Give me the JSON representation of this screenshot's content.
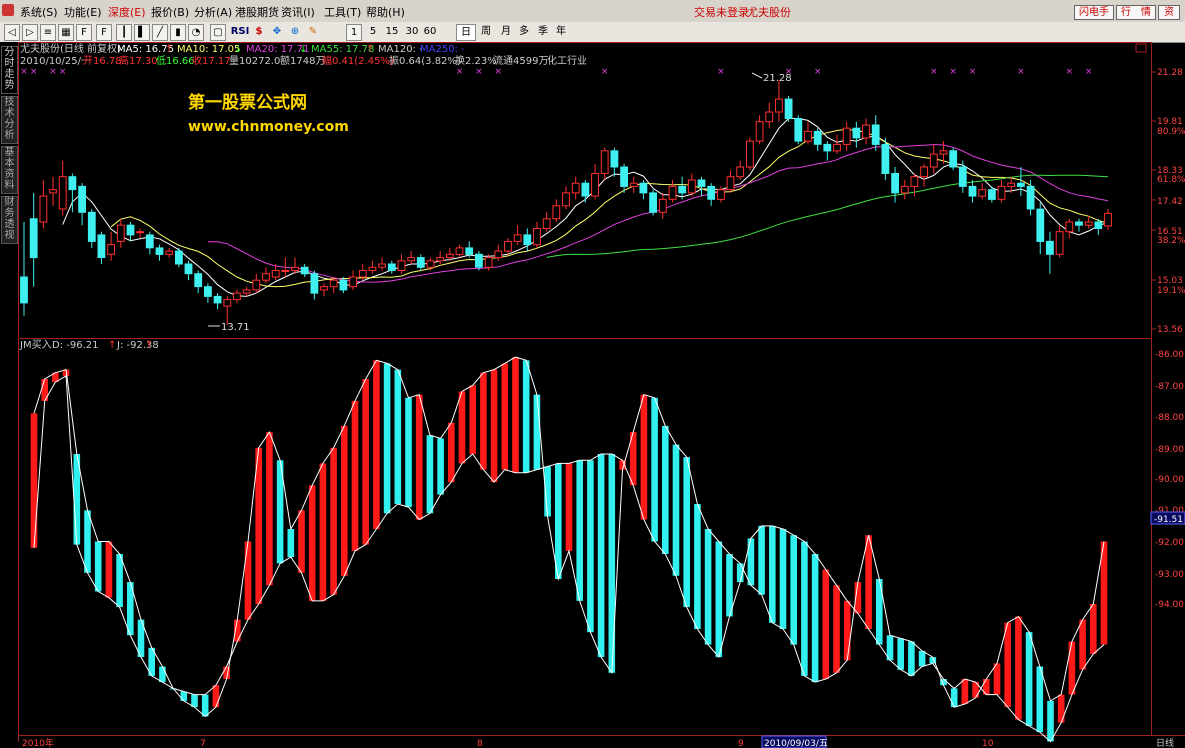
{
  "menubar": {
    "items": [
      "系统(S)",
      "功能(E)",
      "深度(E)",
      "报价(B)",
      "分析(A)",
      "港股期货",
      "资讯(I)",
      "工具(T)",
      "帮助(H)"
    ],
    "status_left": "交易未登录",
    "status_stock": "尤夫股份",
    "btn_flash": "闪电手",
    "btn_quote": "行　情",
    "btn_more": "资"
  },
  "toolbar": {
    "periods": [
      "1",
      "5",
      "15",
      "30",
      "60"
    ],
    "period_tabs": [
      "日",
      "周",
      "月",
      "多",
      "季",
      "年"
    ],
    "rsi_label": "RSI"
  },
  "sidetabs": [
    "分时走势",
    "技术分析",
    "基本资料",
    "财务透视"
  ],
  "watermark": {
    "line1": "第一股票公式网",
    "line2": "www.chnmoney.com"
  },
  "info": {
    "line1": {
      "name": "尤夫股份(日线 前复权)",
      "ma5": "MA5: 16.75",
      "ma10": "MA10: 17.05",
      "ma20": "MA20: 17.71",
      "ma55": "MA55: 17.78",
      "ma120": "MA120: -",
      "ma250": "MA250: -"
    },
    "line2": {
      "date": "2010/10/25/一",
      "open": "开16.78",
      "high": "高17.30",
      "low": "低16.66",
      "close": "收17.17",
      "volume": "量10272.0",
      "amount": "额1748万",
      "change": "幅0.41(2.45%)",
      "amplitude": "振0.64(3.82%)",
      "turnover": "换2.23%",
      "float": "流通4599万",
      "industry": "化工行业"
    },
    "ind_label": "JM买入",
    "ind_d": "D: -96.21",
    "ind_j": "J: -92.38"
  },
  "axis": {
    "price_ticks": [
      "21.28",
      "19.81",
      "18.33",
      "17.42",
      "16.51",
      "15.03",
      "13.56"
    ],
    "fib_ticks": [
      "80.9%",
      "61.8%",
      "38.2%",
      "19.1%"
    ],
    "ind_ticks": [
      "-86.00",
      "-87.00",
      "-88.00",
      "-89.00",
      "-90.00",
      "-91.00",
      "-92.00",
      "-93.00",
      "-94.00"
    ],
    "ind_current": "-91.51",
    "x_ticks": [
      "2010年",
      "7",
      "8",
      "9",
      "10"
    ],
    "cursor_date": "2010/09/03/五",
    "bottom_right": "日线",
    "high_label": "21.28",
    "low_label": "13.71"
  },
  "chart_data": [
    {
      "type": "candlestick",
      "title": "尤夫股份(日线 前复权)",
      "ylim": [
        13.56,
        21.6
      ],
      "ohlc": [
        [
          15.2,
          14.4,
          16.9,
          14.0
        ],
        [
          17.0,
          15.8,
          17.8,
          14.9
        ],
        [
          16.9,
          17.7,
          18.2,
          16.7
        ],
        [
          17.8,
          17.9,
          18.3,
          17.4
        ],
        [
          17.3,
          18.3,
          18.8,
          17.1
        ],
        [
          18.3,
          17.9,
          18.4,
          17.2
        ],
        [
          18.0,
          17.2,
          18.1,
          16.8
        ],
        [
          17.2,
          16.3,
          17.3,
          16.1
        ],
        [
          16.5,
          15.8,
          16.6,
          15.6
        ],
        [
          15.9,
          16.2,
          16.6,
          15.7
        ],
        [
          16.3,
          16.8,
          17.0,
          16.1
        ],
        [
          16.8,
          16.5,
          16.9,
          16.3
        ],
        [
          16.6,
          16.6,
          16.7,
          16.4
        ],
        [
          16.5,
          16.1,
          16.6,
          15.9
        ],
        [
          16.1,
          15.9,
          16.2,
          15.7
        ],
        [
          15.9,
          16.0,
          16.1,
          15.8
        ],
        [
          16.0,
          15.6,
          16.1,
          15.5
        ],
        [
          15.6,
          15.3,
          15.7,
          15.1
        ],
        [
          15.3,
          14.9,
          15.4,
          14.7
        ],
        [
          14.9,
          14.6,
          15.0,
          14.4
        ],
        [
          14.6,
          14.4,
          14.7,
          14.2
        ],
        [
          14.3,
          14.5,
          14.6,
          13.71
        ],
        [
          14.5,
          14.7,
          14.8,
          14.4
        ],
        [
          14.7,
          14.8,
          14.9,
          14.6
        ],
        [
          14.8,
          15.1,
          15.3,
          14.7
        ],
        [
          15.1,
          15.3,
          15.5,
          15.0
        ],
        [
          15.2,
          15.4,
          15.6,
          15.1
        ],
        [
          15.4,
          15.4,
          15.8,
          15.2
        ],
        [
          15.4,
          15.5,
          15.8,
          15.3
        ],
        [
          15.5,
          15.3,
          15.6,
          15.2
        ],
        [
          15.3,
          14.7,
          15.4,
          14.5
        ],
        [
          14.8,
          14.9,
          15.0,
          14.6
        ],
        [
          14.9,
          15.1,
          15.2,
          14.7
        ],
        [
          15.1,
          14.8,
          15.2,
          14.7
        ],
        [
          14.9,
          15.2,
          15.4,
          14.8
        ],
        [
          15.2,
          15.4,
          15.6,
          15.1
        ],
        [
          15.4,
          15.5,
          15.7,
          15.3
        ],
        [
          15.5,
          15.6,
          15.8,
          15.4
        ],
        [
          15.6,
          15.4,
          15.7,
          15.3
        ],
        [
          15.4,
          15.7,
          15.9,
          15.3
        ],
        [
          15.7,
          15.8,
          16.0,
          15.6
        ],
        [
          15.8,
          15.5,
          15.9,
          15.4
        ],
        [
          15.5,
          15.7,
          15.8,
          15.4
        ],
        [
          15.7,
          15.8,
          16.0,
          15.6
        ],
        [
          15.8,
          15.9,
          16.1,
          15.7
        ],
        [
          15.9,
          16.1,
          16.2,
          15.8
        ],
        [
          16.1,
          15.9,
          16.3,
          15.8
        ],
        [
          15.9,
          15.5,
          16.0,
          15.4
        ],
        [
          15.5,
          15.8,
          15.9,
          15.4
        ],
        [
          15.8,
          16.0,
          16.2,
          15.7
        ],
        [
          16.0,
          16.3,
          16.4,
          15.9
        ],
        [
          16.3,
          16.5,
          16.8,
          16.2
        ],
        [
          16.5,
          16.2,
          16.7,
          16.0
        ],
        [
          16.2,
          16.7,
          16.9,
          16.1
        ],
        [
          16.7,
          17.0,
          17.2,
          16.6
        ],
        [
          17.0,
          17.4,
          17.6,
          16.9
        ],
        [
          17.4,
          17.8,
          18.0,
          17.3
        ],
        [
          17.8,
          18.1,
          18.3,
          17.6
        ],
        [
          18.1,
          17.7,
          18.2,
          17.5
        ],
        [
          17.7,
          18.4,
          18.7,
          17.6
        ],
        [
          18.4,
          19.1,
          19.2,
          18.2
        ],
        [
          19.1,
          18.6,
          19.2,
          18.3
        ],
        [
          18.6,
          18.0,
          18.7,
          17.8
        ],
        [
          18.0,
          18.1,
          18.3,
          17.8
        ],
        [
          18.1,
          17.8,
          18.2,
          17.6
        ],
        [
          17.8,
          17.2,
          17.9,
          17.1
        ],
        [
          17.2,
          17.6,
          17.8,
          17.0
        ],
        [
          17.6,
          18.0,
          18.2,
          17.5
        ],
        [
          18.0,
          17.8,
          18.3,
          17.6
        ],
        [
          17.8,
          18.2,
          18.4,
          17.7
        ],
        [
          18.2,
          18.0,
          18.3,
          17.7
        ],
        [
          18.0,
          17.6,
          18.1,
          17.4
        ],
        [
          17.6,
          17.9,
          18.0,
          17.5
        ],
        [
          17.9,
          18.3,
          18.5,
          17.8
        ],
        [
          18.3,
          18.6,
          18.8,
          18.2
        ],
        [
          18.6,
          19.4,
          19.5,
          18.5
        ],
        [
          19.4,
          20.0,
          20.2,
          19.3
        ],
        [
          20.0,
          20.3,
          20.6,
          19.8
        ],
        [
          20.3,
          20.7,
          21.28,
          20.0
        ],
        [
          20.7,
          20.1,
          20.8,
          20.0
        ],
        [
          20.1,
          19.4,
          20.2,
          19.3
        ],
        [
          19.4,
          19.7,
          20.0,
          19.3
        ],
        [
          19.7,
          19.3,
          19.8,
          19.1
        ],
        [
          19.3,
          19.1,
          19.4,
          18.8
        ],
        [
          19.1,
          19.3,
          19.6,
          19.0
        ],
        [
          19.3,
          19.8,
          20.0,
          19.1
        ],
        [
          19.8,
          19.5,
          20.0,
          19.2
        ],
        [
          19.5,
          19.9,
          20.1,
          19.3
        ],
        [
          19.9,
          19.3,
          20.2,
          19.1
        ],
        [
          19.3,
          18.4,
          19.5,
          18.2
        ],
        [
          18.4,
          17.8,
          18.6,
          17.5
        ],
        [
          17.8,
          18.0,
          18.2,
          17.6
        ],
        [
          18.0,
          18.3,
          18.4,
          17.7
        ],
        [
          18.3,
          18.6,
          18.7,
          18.0
        ],
        [
          18.6,
          19.0,
          19.3,
          18.4
        ],
        [
          19.0,
          19.1,
          19.4,
          18.7
        ],
        [
          19.1,
          18.6,
          19.2,
          18.5
        ],
        [
          18.6,
          18.0,
          18.8,
          17.8
        ],
        [
          18.0,
          17.7,
          18.2,
          17.5
        ],
        [
          17.7,
          17.9,
          18.1,
          17.6
        ],
        [
          17.9,
          17.6,
          18.0,
          17.5
        ],
        [
          17.6,
          18.0,
          18.2,
          17.5
        ],
        [
          18.0,
          18.1,
          18.3,
          17.8
        ],
        [
          18.1,
          18.0,
          18.6,
          17.7
        ],
        [
          18.0,
          17.3,
          18.2,
          17.1
        ],
        [
          17.3,
          16.3,
          17.5,
          15.9
        ],
        [
          16.3,
          15.9,
          16.6,
          15.3
        ],
        [
          15.9,
          16.6,
          16.8,
          15.8
        ],
        [
          16.6,
          16.9,
          17.0,
          16.4
        ],
        [
          16.9,
          16.8,
          17.0,
          16.6
        ],
        [
          16.8,
          16.9,
          17.1,
          16.7
        ],
        [
          16.9,
          16.7,
          17.0,
          16.5
        ],
        [
          16.78,
          17.17,
          17.3,
          16.66
        ]
      ],
      "high_annotation": 21.28,
      "low_annotation": 13.71
    },
    {
      "type": "bar",
      "title": "JM买入",
      "ylim": [
        -95.2,
        -85.8
      ],
      "series": [
        {
          "name": "D",
          "values": [
            -92.2,
            -87.5,
            -86.9,
            -86.7,
            -92.1,
            -93.0,
            -93.6,
            -93.8,
            -94.1,
            -95.0,
            -95.7,
            -96.3,
            -96.5,
            -96.7,
            -96.8,
            -96.9,
            -96.9,
            -96.6,
            -96.0,
            -95.2,
            -94.5,
            -94.0,
            -93.4,
            -92.7,
            -92.5,
            -93.0,
            -93.9,
            -93.9,
            -93.7,
            -93.1,
            -92.3,
            -92.1,
            -91.6,
            -91.1,
            -90.8,
            -90.9,
            -91.3,
            -91.1,
            -90.5,
            -90.1,
            -89.5,
            -89.2,
            -89.7,
            -90.1,
            -89.7,
            -89.8,
            -89.8,
            -89.7,
            -89.6,
            -89.5,
            -89.5,
            -89.4,
            -89.4,
            -89.2,
            -89.2,
            -89.4,
            -90.2,
            -91.3,
            -92.0,
            -92.4,
            -93.1,
            -94.1,
            -94.8,
            -95.3,
            -95.7,
            -94.4,
            -93.3,
            -91.9,
            -91.5,
            -91.5,
            -91.6,
            -91.8,
            -92.0,
            -92.4,
            -92.9,
            -93.4,
            -93.9,
            -94.3,
            -94.8,
            -95.3,
            -95.8,
            -96.1,
            -96.3,
            -96.0,
            -95.9,
            -96.4,
            -96.7,
            -96.4,
            -96.5,
            -96.9,
            -96.9,
            -97.3,
            -97.7,
            -97.9,
            -98.1,
            -98.4,
            -97.8,
            -96.9,
            -96.1,
            -95.6,
            -95.3
          ]
        },
        {
          "name": "J",
          "values": [
            -87.9,
            -86.8,
            -86.6,
            -86.5,
            -89.2,
            -91.0,
            -92.0,
            -92.0,
            -92.4,
            -93.3,
            -94.5,
            -95.4,
            -96.0,
            -96.7,
            -97.1,
            -97.3,
            -97.6,
            -97.3,
            -96.4,
            -94.5,
            -92.0,
            -89.0,
            -88.5,
            -89.4,
            -91.6,
            -91.0,
            -90.2,
            -89.5,
            -89.0,
            -88.3,
            -87.5,
            -86.8,
            -86.2,
            -86.3,
            -86.5,
            -87.4,
            -87.3,
            -88.6,
            -88.7,
            -88.2,
            -87.2,
            -87.0,
            -86.6,
            -86.5,
            -86.3,
            -86.1,
            -86.2,
            -87.3,
            -91.2,
            -93.2,
            -92.3,
            -93.9,
            -94.9,
            -95.7,
            -96.2,
            -89.7,
            -88.5,
            -87.3,
            -87.4,
            -88.3,
            -88.9,
            -89.3,
            -90.8,
            -91.6,
            -92.0,
            -92.4,
            -92.7,
            -93.4,
            -93.7,
            -94.6,
            -94.8,
            -95.3,
            -96.3,
            -96.5,
            -96.4,
            -96.2,
            -95.8,
            -93.3,
            -91.8,
            -93.2,
            -95.0,
            -95.1,
            -95.2,
            -95.5,
            -95.7,
            -96.6,
            -97.3,
            -97.2,
            -97.0,
            -96.4,
            -95.9,
            -94.6,
            -94.4,
            -94.9,
            -96.0,
            -97.1,
            -96.9,
            -95.2,
            -94.5,
            -94.0,
            -92.0
          ]
        }
      ]
    }
  ]
}
